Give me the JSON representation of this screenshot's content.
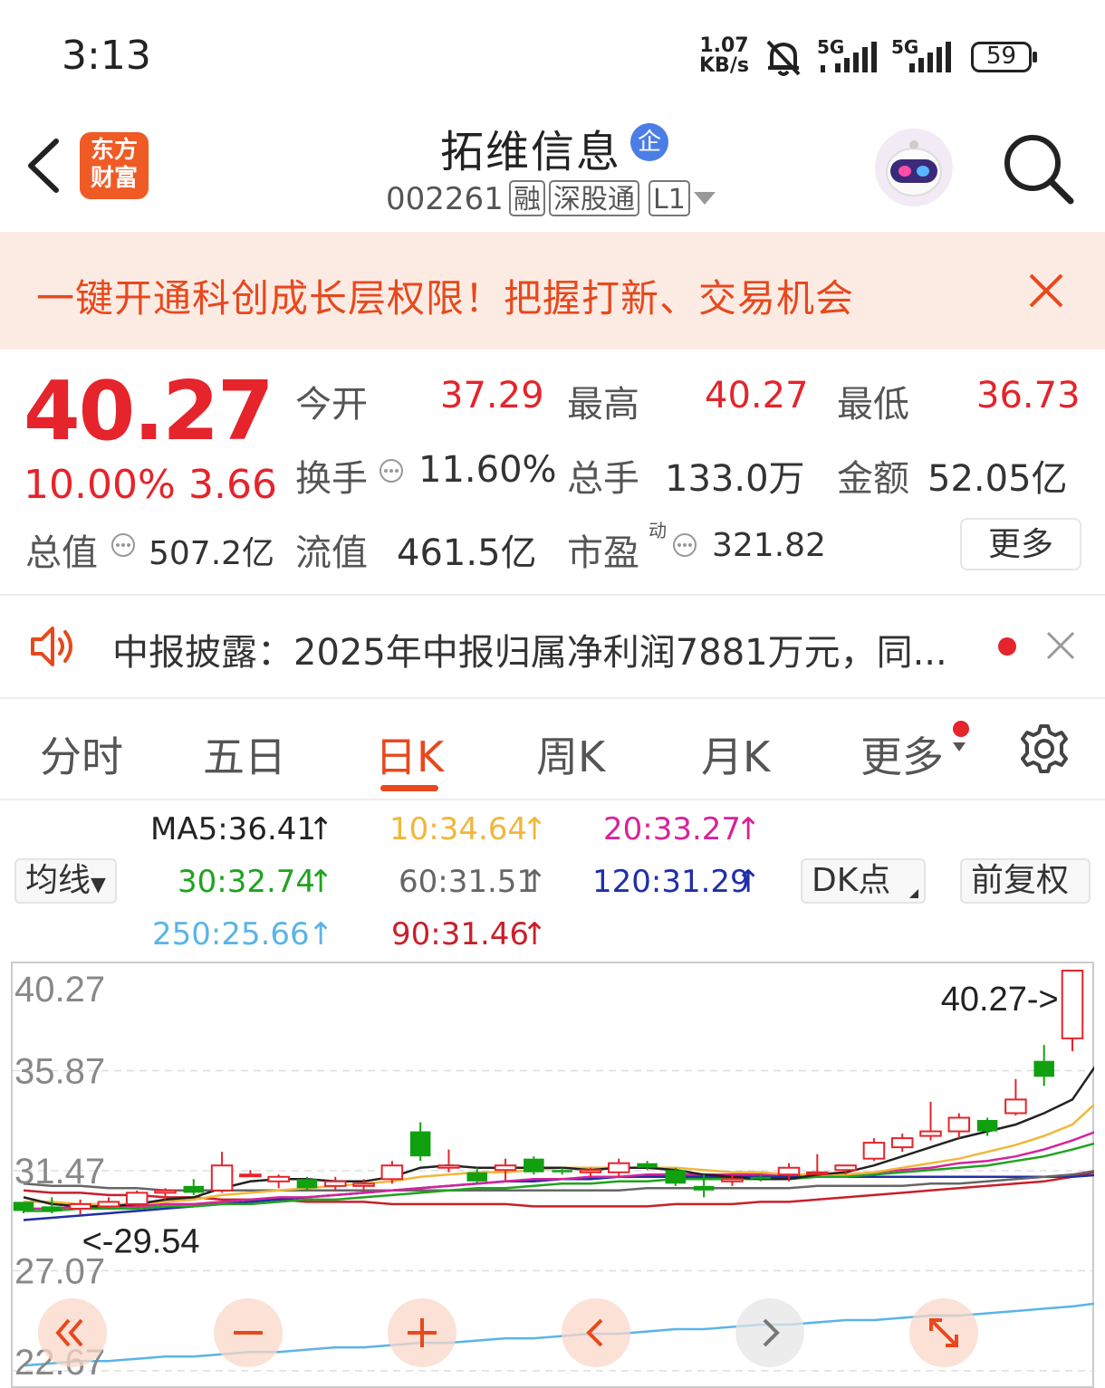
{
  "status_bar": {
    "time": "3:13",
    "net_speed_value": "1.07",
    "net_speed_unit": "KB/s",
    "sim1": "5G",
    "sim2": "5G",
    "battery": "59",
    "icons": [
      "bell-muted-icon",
      "signal-icon",
      "battery-icon"
    ]
  },
  "header": {
    "logo_line1": "东方",
    "logo_line2": "财富",
    "stock_name": "拓维信息",
    "badge": "企",
    "stock_code": "002261",
    "tags": [
      "融",
      "深股通",
      "L1"
    ],
    "icons": [
      "back-icon",
      "robot-avatar",
      "search-icon"
    ]
  },
  "promo": {
    "text": "一键开通科创成长层权限！把握打新、交易机会"
  },
  "quote": {
    "price": "40.27",
    "change_pct": "10.00%",
    "change": "3.66",
    "open_label": "今开",
    "open": "37.29",
    "high_label": "最高",
    "high": "40.27",
    "low_label": "最低",
    "low": "36.73",
    "turnover_label": "换手",
    "turnover": "11.60%",
    "volume_label": "总手",
    "volume": "133.0万",
    "amount_label": "金额",
    "amount": "52.05亿",
    "mktcap_label": "总值",
    "mktcap": "507.2亿",
    "float_label": "流值",
    "float": "461.5亿",
    "pe_label": "市盈",
    "pe_sup": "动",
    "pe": "321.82",
    "more": "更多"
  },
  "news": {
    "text": "中报披露：2025年中报归属净利润7881万元，同..."
  },
  "tabs": [
    "分时",
    "五日",
    "日K",
    "周K",
    "月K",
    "更多"
  ],
  "active_tab": "日K",
  "ma": {
    "selector": "均线",
    "ma5": "MA5:36.41",
    "ma10": "10:34.64",
    "ma20": "20:33.27",
    "ma30": "30:32.74",
    "ma60": "60:31.51",
    "ma120": "120:31.29",
    "ma250": "250:25.66",
    "ma90": "90:31.46",
    "dk": "DK点",
    "fq": "前复权",
    "colors": {
      "ma5": "#222222",
      "ma10": "#f0b73a",
      "ma20": "#d6239a",
      "ma30": "#1fa31f",
      "ma60": "#666666",
      "ma120": "#1f2fa8",
      "ma250": "#5ab4e8",
      "ma90": "#c8202a"
    }
  },
  "chart_data": {
    "type": "candlestick",
    "y_ticks": [
      "40.27",
      "35.87",
      "31.47",
      "27.07",
      "22.67"
    ],
    "ylim": [
      22.67,
      40.27
    ],
    "max_label": "40.27->",
    "min_label": "<-29.54",
    "up_color": "#e5242b",
    "down_color": "#10a010",
    "candles": [
      {
        "o": 30.1,
        "h": 30.1,
        "l": 29.6,
        "c": 29.7
      },
      {
        "o": 29.9,
        "h": 30.3,
        "l": 29.6,
        "c": 29.7
      },
      {
        "o": 29.8,
        "h": 30.2,
        "l": 29.54,
        "c": 30.0
      },
      {
        "o": 29.9,
        "h": 30.3,
        "l": 29.8,
        "c": 30.1
      },
      {
        "o": 30.0,
        "h": 30.6,
        "l": 29.9,
        "c": 30.5
      },
      {
        "o": 30.5,
        "h": 30.7,
        "l": 30.2,
        "c": 30.6
      },
      {
        "o": 30.8,
        "h": 31.1,
        "l": 30.4,
        "c": 30.5
      },
      {
        "o": 30.6,
        "h": 32.3,
        "l": 30.5,
        "c": 31.7
      },
      {
        "o": 31.3,
        "h": 31.5,
        "l": 31.2,
        "c": 31.3
      },
      {
        "o": 31.0,
        "h": 31.3,
        "l": 30.7,
        "c": 31.2
      },
      {
        "o": 31.1,
        "h": 31.2,
        "l": 30.6,
        "c": 30.7
      },
      {
        "o": 30.8,
        "h": 31.2,
        "l": 30.6,
        "c": 31.0
      },
      {
        "o": 30.8,
        "h": 31.1,
        "l": 30.6,
        "c": 30.9
      },
      {
        "o": 31.1,
        "h": 31.9,
        "l": 30.9,
        "c": 31.7
      },
      {
        "o": 33.2,
        "h": 33.6,
        "l": 31.9,
        "c": 32.1
      },
      {
        "o": 31.6,
        "h": 32.4,
        "l": 31.4,
        "c": 31.7
      },
      {
        "o": 31.4,
        "h": 31.6,
        "l": 30.9,
        "c": 31.0
      },
      {
        "o": 31.5,
        "h": 32.0,
        "l": 31.0,
        "c": 31.7
      },
      {
        "o": 32.0,
        "h": 32.1,
        "l": 31.3,
        "c": 31.4
      },
      {
        "o": 31.5,
        "h": 31.6,
        "l": 31.3,
        "c": 31.4
      },
      {
        "o": 31.4,
        "h": 31.6,
        "l": 31.2,
        "c": 31.5
      },
      {
        "o": 31.4,
        "h": 32.0,
        "l": 31.2,
        "c": 31.8
      },
      {
        "o": 31.8,
        "h": 31.9,
        "l": 31.5,
        "c": 31.6
      },
      {
        "o": 31.5,
        "h": 31.6,
        "l": 30.8,
        "c": 30.9
      },
      {
        "o": 30.8,
        "h": 31.3,
        "l": 30.3,
        "c": 30.6
      },
      {
        "o": 31.0,
        "h": 31.3,
        "l": 30.8,
        "c": 31.1
      },
      {
        "o": 31.2,
        "h": 31.3,
        "l": 31.0,
        "c": 31.1
      },
      {
        "o": 31.3,
        "h": 31.8,
        "l": 31.0,
        "c": 31.6
      },
      {
        "o": 31.4,
        "h": 32.2,
        "l": 31.3,
        "c": 31.4
      },
      {
        "o": 31.5,
        "h": 31.7,
        "l": 31.3,
        "c": 31.7
      },
      {
        "o": 32.0,
        "h": 32.9,
        "l": 31.9,
        "c": 32.7
      },
      {
        "o": 32.5,
        "h": 33.1,
        "l": 32.3,
        "c": 32.9
      },
      {
        "o": 33.0,
        "h": 34.5,
        "l": 32.8,
        "c": 33.2
      },
      {
        "o": 33.2,
        "h": 34.0,
        "l": 32.9,
        "c": 33.8
      },
      {
        "o": 33.7,
        "h": 33.8,
        "l": 33.0,
        "c": 33.2
      },
      {
        "o": 34.0,
        "h": 35.5,
        "l": 33.9,
        "c": 34.6
      },
      {
        "o": 36.3,
        "h": 37.0,
        "l": 35.2,
        "c": 35.6
      },
      {
        "o": 37.29,
        "h": 40.27,
        "l": 36.73,
        "c": 40.27
      }
    ],
    "ma_lines": {
      "ma5": [
        30.3,
        30.0,
        29.9,
        29.9,
        30.0,
        30.2,
        30.3,
        30.7,
        31.0,
        31.1,
        31.1,
        31.0,
        31.0,
        31.2,
        31.6,
        31.7,
        31.6,
        31.6,
        31.6,
        31.6,
        31.5,
        31.6,
        31.6,
        31.5,
        31.3,
        31.2,
        31.1,
        31.1,
        31.3,
        31.4,
        31.7,
        32.1,
        32.5,
        32.9,
        33.2,
        33.5,
        34.0,
        34.6,
        36.41
      ],
      "ma10": [
        30.1,
        30.1,
        30.0,
        30.0,
        30.0,
        30.1,
        30.2,
        30.4,
        30.5,
        30.6,
        30.7,
        30.8,
        30.9,
        31.0,
        31.2,
        31.3,
        31.4,
        31.4,
        31.5,
        31.6,
        31.6,
        31.6,
        31.6,
        31.6,
        31.5,
        31.4,
        31.4,
        31.3,
        31.3,
        31.3,
        31.4,
        31.6,
        31.8,
        32.0,
        32.3,
        32.6,
        33.0,
        33.5,
        34.64
      ],
      "ma20": [
        29.8,
        29.8,
        29.9,
        29.9,
        29.9,
        30.0,
        30.0,
        30.1,
        30.2,
        30.3,
        30.3,
        30.4,
        30.5,
        30.6,
        30.7,
        30.8,
        30.9,
        31.0,
        31.1,
        31.1,
        31.2,
        31.2,
        31.3,
        31.3,
        31.3,
        31.3,
        31.3,
        31.3,
        31.3,
        31.3,
        31.4,
        31.5,
        31.6,
        31.8,
        31.9,
        32.1,
        32.4,
        32.8,
        33.27
      ],
      "ma30": [
        29.7,
        29.7,
        29.8,
        29.8,
        29.8,
        29.9,
        29.9,
        30.0,
        30.0,
        30.1,
        30.2,
        30.2,
        30.3,
        30.4,
        30.5,
        30.6,
        30.7,
        30.7,
        30.8,
        30.9,
        30.9,
        31.0,
        31.0,
        31.1,
        31.1,
        31.1,
        31.1,
        31.1,
        31.2,
        31.2,
        31.3,
        31.4,
        31.5,
        31.6,
        31.7,
        31.9,
        32.1,
        32.4,
        32.74
      ],
      "ma60": [
        30.9,
        30.8,
        30.8,
        30.7,
        30.7,
        30.6,
        30.6,
        30.6,
        30.6,
        30.6,
        30.6,
        30.6,
        30.6,
        30.6,
        30.6,
        30.6,
        30.6,
        30.6,
        30.6,
        30.6,
        30.6,
        30.6,
        30.7,
        30.7,
        30.7,
        30.7,
        30.7,
        30.7,
        30.8,
        30.8,
        30.8,
        30.8,
        30.9,
        30.9,
        31.0,
        31.1,
        31.2,
        31.3,
        31.51
      ],
      "ma120": [
        29.3,
        29.4,
        29.5,
        29.6,
        29.7,
        29.8,
        29.9,
        30.0,
        30.1,
        30.2,
        30.3,
        30.4,
        30.5,
        30.6,
        30.7,
        30.8,
        30.9,
        31.0,
        31.0,
        31.1,
        31.1,
        31.2,
        31.2,
        31.2,
        31.2,
        31.2,
        31.2,
        31.2,
        31.2,
        31.2,
        31.2,
        31.2,
        31.2,
        31.2,
        31.2,
        31.2,
        31.2,
        31.2,
        31.29
      ],
      "ma90": [
        30.6,
        30.5,
        30.5,
        30.4,
        30.4,
        30.3,
        30.3,
        30.2,
        30.2,
        30.2,
        30.1,
        30.1,
        30.1,
        30.0,
        30.0,
        30.0,
        30.0,
        30.0,
        29.9,
        29.9,
        29.9,
        29.9,
        29.9,
        30.0,
        30.0,
        30.0,
        30.1,
        30.1,
        30.2,
        30.3,
        30.4,
        30.5,
        30.6,
        30.7,
        30.8,
        30.9,
        31.0,
        31.2,
        31.46
      ],
      "ma250": [
        22.9,
        23.0,
        23.1,
        23.1,
        23.2,
        23.3,
        23.3,
        23.4,
        23.5,
        23.5,
        23.6,
        23.7,
        23.7,
        23.8,
        23.9,
        23.9,
        24.0,
        24.1,
        24.1,
        24.2,
        24.3,
        24.3,
        24.4,
        24.5,
        24.5,
        24.6,
        24.7,
        24.7,
        24.8,
        24.9,
        24.9,
        25.0,
        25.1,
        25.1,
        25.2,
        25.3,
        25.4,
        25.5,
        25.66
      ]
    },
    "controls": [
      "double-left-icon",
      "zoom-out-icon",
      "zoom-in-icon",
      "left-icon",
      "right-icon",
      "fullscreen-icon"
    ]
  }
}
